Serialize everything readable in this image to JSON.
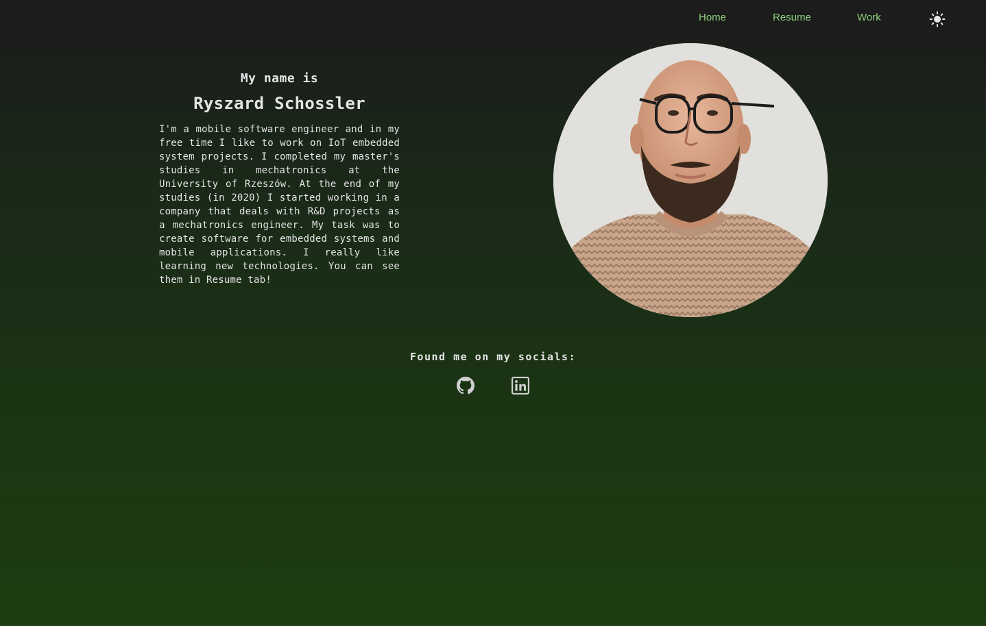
{
  "nav": {
    "items": [
      {
        "label": "Home"
      },
      {
        "label": "Resume"
      },
      {
        "label": "Work"
      }
    ],
    "theme_toggle_icon": "sun-icon",
    "link_color": "#8fcf7c"
  },
  "intro": {
    "kicker": "My name is",
    "name": "Ryszard Schossler",
    "bio": "I'm a mobile software engineer and in my free time I like to work on IoT embedded system projects. I completed my master's studies in mechatronics at the University of Rzeszów. At the end of my studies (in 2020) I started working in a company that deals with R&D projects as a mechatronics engineer. My task was to create software for embedded systems and mobile applications. I really like learning new technologies. You can see them in Resume tab!"
  },
  "socials": {
    "title": "Found me on my socials:",
    "links": [
      {
        "icon": "github-icon"
      },
      {
        "icon": "linkedin-icon"
      }
    ]
  }
}
